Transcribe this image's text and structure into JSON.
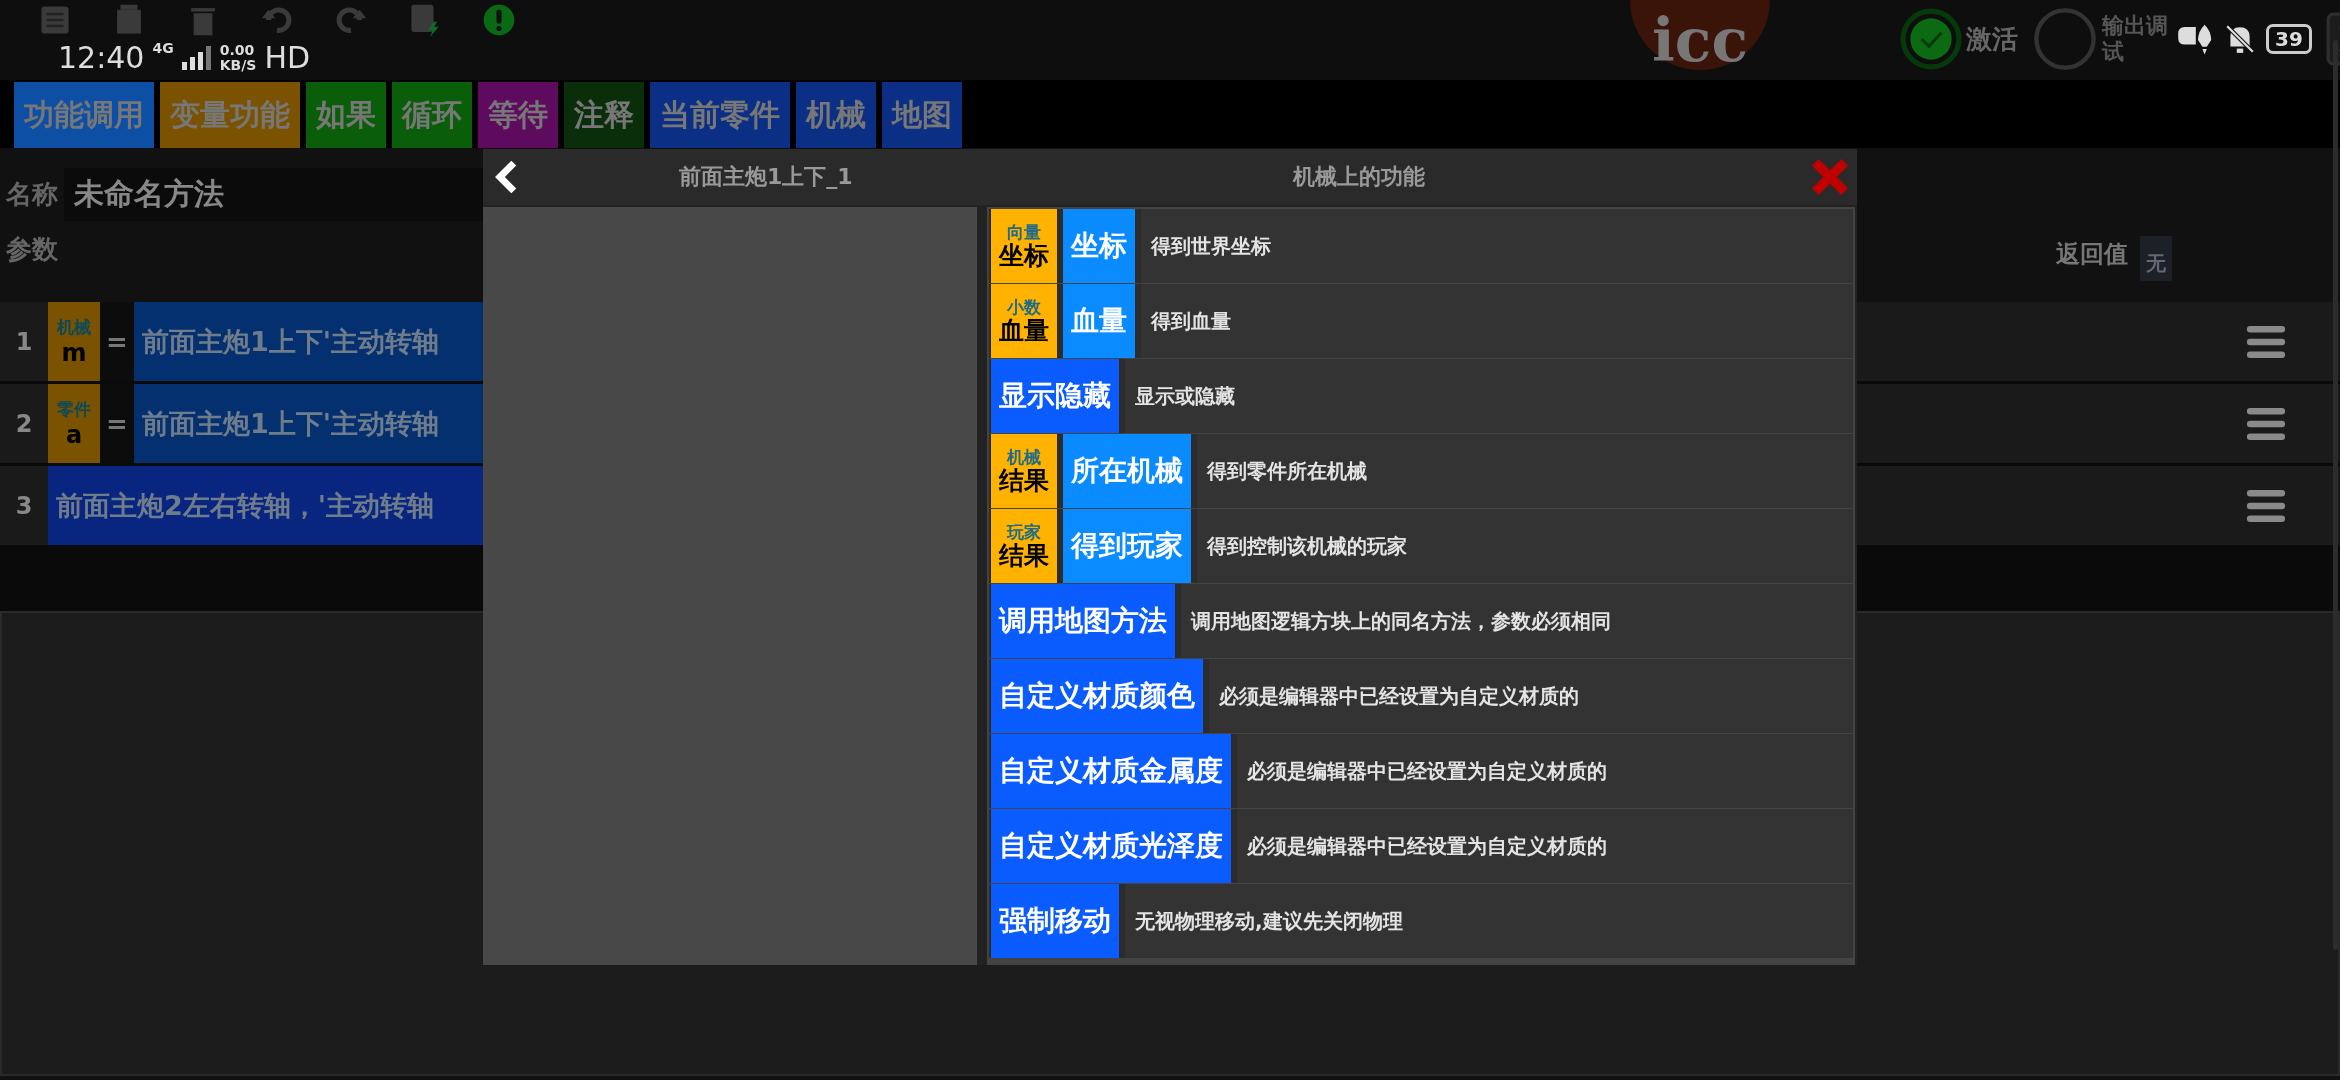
{
  "status_bar": {
    "time": "12:40",
    "network": "4G",
    "speed_value": "0.00",
    "speed_unit": "KB/S",
    "hd": "HD",
    "battery": "39"
  },
  "app_bar": {
    "logo": "icc",
    "activate": "激活",
    "debug_output": "输出调",
    "debug_output_line2": "试"
  },
  "tabs": [
    {
      "label": "功能调用",
      "color": "#0e4fa6"
    },
    {
      "label": "变量功能",
      "color": "#7a5200"
    },
    {
      "label": "如果",
      "color": "#0a5e0a"
    },
    {
      "label": "循环",
      "color": "#0a5e0a"
    },
    {
      "label": "等待",
      "color": "#5e0a5e"
    },
    {
      "label": "注释",
      "color": "#0a2e0a"
    },
    {
      "label": "当前零件",
      "color": "#0c2f86"
    },
    {
      "label": "机械",
      "color": "#0c2f86"
    },
    {
      "label": "地图",
      "color": "#0c2f86"
    }
  ],
  "method": {
    "name_label": "名称",
    "name_value": "未命名方法",
    "params_label": "参数",
    "return_label": "返回值",
    "return_value": "无"
  },
  "statements": [
    {
      "number": "1",
      "kind": "assign",
      "var_type": "机械",
      "var_name": "m",
      "operator": "=",
      "expression": "前面主炮1上下'主动转轴"
    },
    {
      "number": "2",
      "kind": "assign",
      "var_type": "零件",
      "var_name": "a",
      "operator": "=",
      "expression": "前面主炮1上下'主动转轴"
    },
    {
      "number": "3",
      "kind": "call",
      "expression": "前面主炮2左右转轴，'主动转轴"
    }
  ],
  "dialog": {
    "left_title": "前面主炮1上下_1",
    "right_title": "机械上的功能",
    "functions": [
      {
        "kind": "typed",
        "type_label": "向量",
        "type_name": "坐标",
        "name": "坐标",
        "description": "得到世界坐标"
      },
      {
        "kind": "typed",
        "type_label": "小数",
        "type_name": "血量",
        "name": "血量",
        "description": "得到血量"
      },
      {
        "kind": "plain",
        "name": "显示隐藏",
        "description": "显示或隐藏"
      },
      {
        "kind": "typed",
        "type_label": "机械",
        "type_name": "结果",
        "name": "所在机械",
        "description": "得到零件所在机械"
      },
      {
        "kind": "typed",
        "type_label": "玩家",
        "type_name": "结果",
        "name": "得到玩家",
        "description": "得到控制该机械的玩家"
      },
      {
        "kind": "plain",
        "name": "调用地图方法",
        "description": "调用地图逻辑方块上的同名方法，参数必须相同"
      },
      {
        "kind": "plain",
        "name": "自定义材质颜色",
        "description": "必须是编辑器中已经设置为自定义材质的"
      },
      {
        "kind": "plain",
        "name": "自定义材质金属度",
        "description": "必须是编辑器中已经设置为自定义材质的"
      },
      {
        "kind": "plain",
        "name": "自定义材质光泽度",
        "description": "必须是编辑器中已经设置为自定义材质的"
      },
      {
        "kind": "plain",
        "name": "强制移动",
        "description": "无视物理移动,建议先关闭物理"
      }
    ]
  }
}
